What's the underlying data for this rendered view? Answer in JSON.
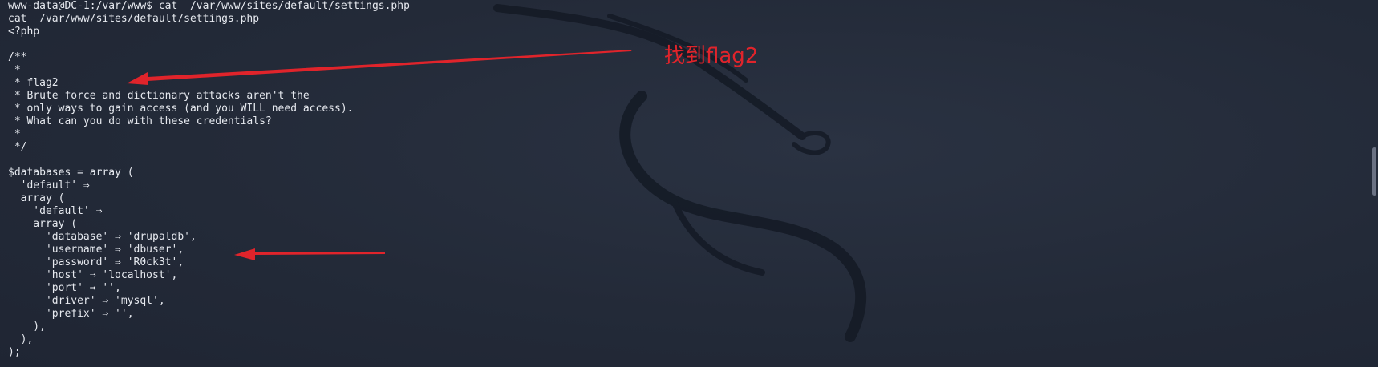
{
  "terminal": {
    "lines": [
      "www-data@DC-1:/var/www$ cat  /var/www/sites/default/settings.php",
      "cat  /var/www/sites/default/settings.php",
      "<?php",
      "",
      "/**",
      " *",
      " * flag2",
      " * Brute force and dictionary attacks aren't the",
      " * only ways to gain access (and you WILL need access).",
      " * What can you do with these credentials?",
      " *",
      " */",
      "",
      "$databases = array (",
      "  'default' ⇒",
      "  array (",
      "    'default' ⇒",
      "    array (",
      "      'database' ⇒ 'drupaldb',",
      "      'username' ⇒ 'dbuser',",
      "      'password' ⇒ 'R0ck3t',",
      "      'host' ⇒ 'localhost',",
      "      'port' ⇒ '',",
      "      'driver' ⇒ 'mysql',",
      "      'prefix' ⇒ '',",
      "    ),",
      "  ),",
      ");"
    ]
  },
  "annotation": {
    "text": "找到flag2",
    "color": "#e0242b"
  },
  "colors": {
    "background": "#232a38",
    "foreground": "#e6e9ef",
    "arrow": "#e0242b"
  }
}
